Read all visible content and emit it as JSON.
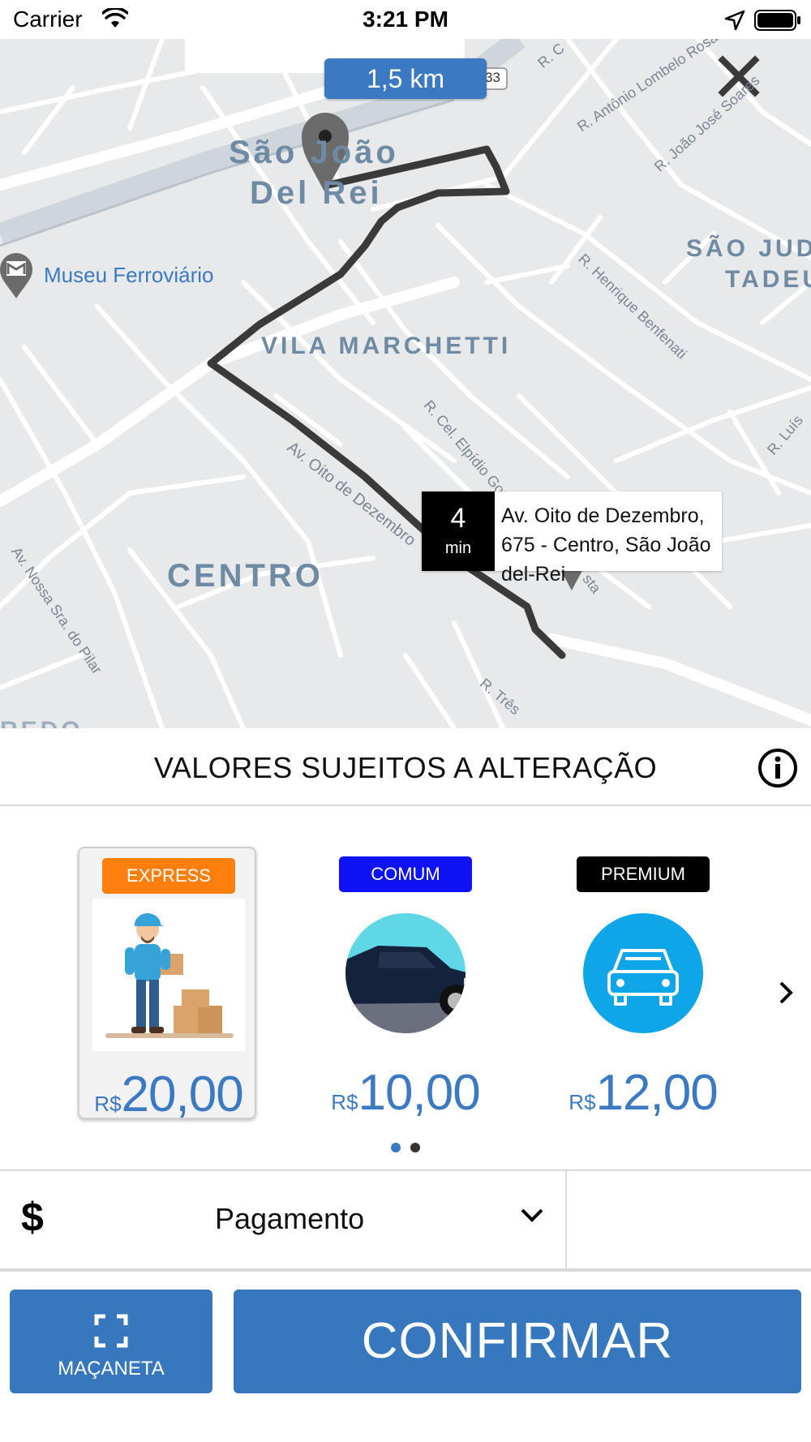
{
  "status_bar": {
    "carrier": "Carrier",
    "time": "3:21 PM"
  },
  "map": {
    "distance": "1,5 km",
    "areas": [
      "São João",
      "Del Rei",
      "VILA MARCHETTI",
      "SÃO JUD",
      "TADEU",
      "CENTRO",
      "REDO"
    ],
    "museum": "Museu Ferroviário",
    "streets": [
      "R. Antônio Lombelo Rosa",
      "R. João José Soares",
      "R. Henrique Benfenati",
      "R. Cel. Elpídio Gomes",
      "Av. Oito de Dezembro",
      "Av. Nossa Sra. do Pilar",
      "R. Três",
      "R. Luís",
      "R. C",
      "33",
      "sta"
    ],
    "eta": {
      "minutes": "4",
      "unit": "min",
      "address": "Av. Oito de Dezembro, 675 - Centro, São João del-Rei"
    },
    "route_color": "#3a3a3a",
    "pin_color": "#6b6b6b"
  },
  "notice": {
    "text": "VALORES SUJEITOS A ALTERAÇÃO"
  },
  "options": [
    {
      "tag": "EXPRESS",
      "tag_color": "#ff7f0e",
      "currency": "R$",
      "price": "20,00",
      "selected": true,
      "icon": "delivery-man-image"
    },
    {
      "tag": "COMUM",
      "tag_color": "#0f12f5",
      "currency": "R$",
      "price": "10,00",
      "selected": false,
      "icon": "car-photo-image"
    },
    {
      "tag": "PREMIUM",
      "tag_color": "#000000",
      "currency": "R$",
      "price": "12,00",
      "selected": false,
      "icon": "car-outline-image"
    }
  ],
  "pager": {
    "active_color": "#3b7ac3",
    "inactive_color": "#333333"
  },
  "payment": {
    "icon": "dollar-icon",
    "label": "Pagamento"
  },
  "buttons": {
    "handle_label": "MAÇANETA",
    "confirm_label": "CONFIRMAR"
  },
  "colors": {
    "primary": "#3677bd",
    "price_text": "#3b7ac3"
  }
}
